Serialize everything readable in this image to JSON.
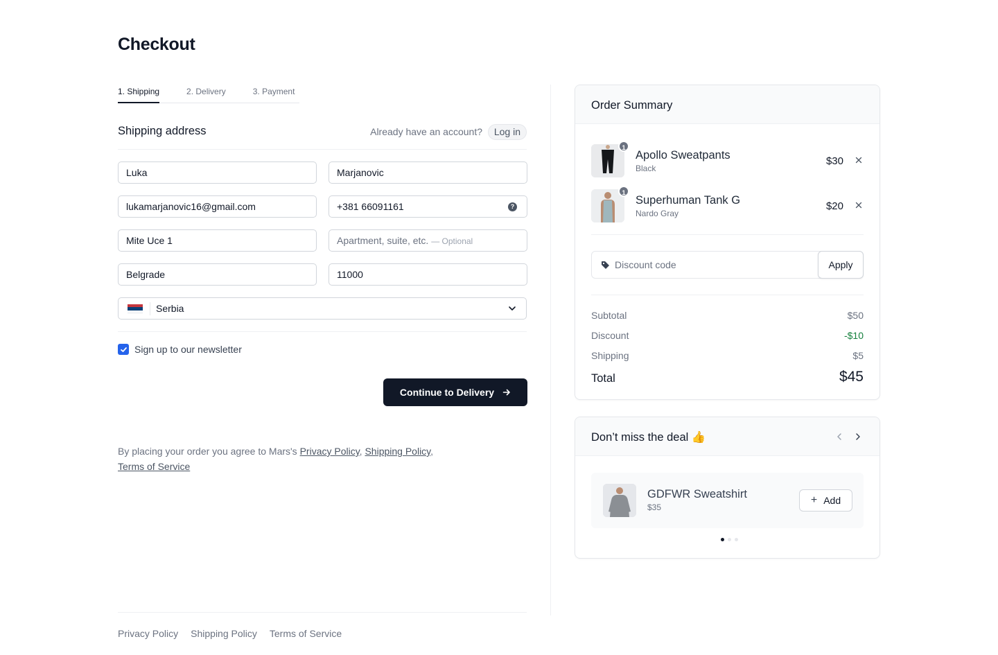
{
  "page": {
    "title": "Checkout"
  },
  "tabs": [
    {
      "label": "1. Shipping",
      "active": true
    },
    {
      "label": "2. Delivery",
      "active": false
    },
    {
      "label": "3. Payment",
      "active": false
    }
  ],
  "shipping": {
    "title": "Shipping address",
    "account_question": "Already have an account?",
    "login_label": "Log in",
    "first_name": "Luka",
    "last_name": "Marjanovic",
    "email": "lukamarjanovic16@gmail.com",
    "phone": "+381 66091161",
    "address": "Mite Uce 1",
    "apartment_placeholder": "Apartment, suite, etc.",
    "apartment_optional": "— Optional",
    "city": "Belgrade",
    "postal_code": "11000",
    "country": "Serbia",
    "newsletter_label": "Sign up to our newsletter",
    "newsletter_checked": true,
    "continue_label": "Continue to Delivery"
  },
  "legal": {
    "prefix": "By placing your order you agree to Mars's",
    "privacy": "Privacy Policy",
    "shipping": "Shipping Policy",
    "terms": "Terms of Service"
  },
  "footer": {
    "links": [
      "Privacy Policy",
      "Shipping Policy",
      "Terms of Service"
    ]
  },
  "order_summary": {
    "title": "Order Summary",
    "items": [
      {
        "name": "Apollo Sweatpants",
        "variant": "Black",
        "price": "$30",
        "qty": "1"
      },
      {
        "name": "Superhuman Tank G",
        "variant": "Nardo Gray",
        "price": "$20",
        "qty": "1"
      }
    ],
    "discount_placeholder": "Discount code",
    "apply_label": "Apply",
    "subtotal_label": "Subtotal",
    "subtotal": "$50",
    "discount_label": "Discount",
    "discount": "-$10",
    "shipping_label": "Shipping",
    "shipping": "$5",
    "total_label": "Total",
    "total": "$45",
    "discount_color": "#15803d"
  },
  "deal": {
    "title": "Don’t miss the deal 👍",
    "item_name": "GDFWR Sweatshirt",
    "item_price": "$35",
    "add_label": "Add",
    "slides": 3,
    "active_slide": 1
  },
  "colors": {
    "primary": "#111827",
    "checkbox": "#2563eb",
    "accent_green": "#15803d"
  }
}
